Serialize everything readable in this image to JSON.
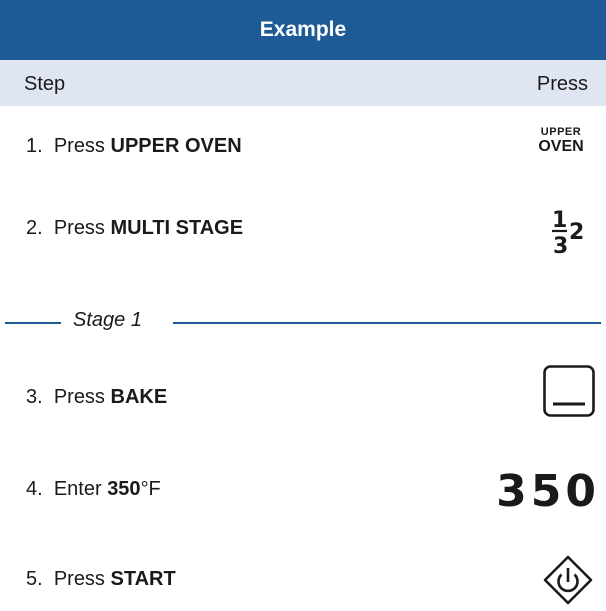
{
  "header": {
    "title": "Example",
    "col_step": "Step",
    "col_press": "Press"
  },
  "steps": [
    {
      "num": "1.",
      "verb": "Press",
      "bold": "UPPER OVEN",
      "suffix": ""
    },
    {
      "num": "2.",
      "verb": "Press",
      "bold": "MULTI STAGE",
      "suffix": ""
    },
    {
      "num": "3.",
      "verb": "Press",
      "bold": "BAKE",
      "suffix": ""
    },
    {
      "num": "4.",
      "verb": "Enter",
      "bold": "350",
      "suffix": "°F"
    },
    {
      "num": "5.",
      "verb": "Press",
      "bold": "START",
      "suffix": ""
    }
  ],
  "stage": {
    "label": "Stage 1"
  },
  "keys": {
    "upper_oven_line1": "UPPER",
    "upper_oven_line2": "OVEN",
    "multi_stage_icon": "multi-stage-icon",
    "bake_icon": "bake-icon",
    "display_value": "350",
    "start_icon": "start-icon"
  },
  "colors": {
    "brand_blue": "#1d5a96",
    "header_band": "#dfe6f1"
  }
}
